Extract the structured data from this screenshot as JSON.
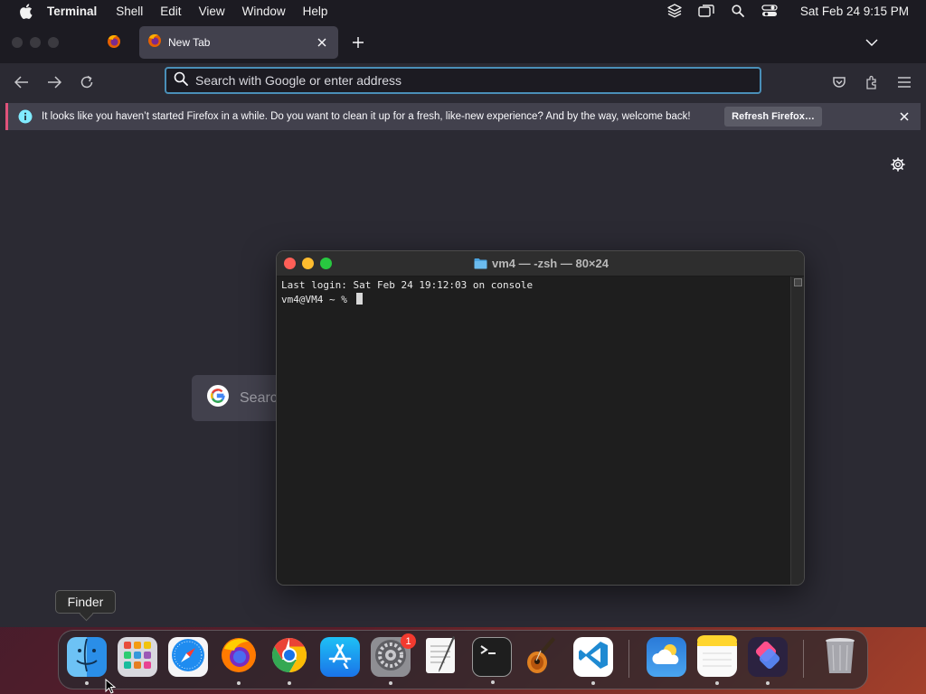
{
  "menubar": {
    "apple_icon": "apple-logo",
    "app_name": "Terminal",
    "menus": [
      "Shell",
      "Edit",
      "View",
      "Window",
      "Help"
    ],
    "status_icons": [
      "layers-icon",
      "screen-mirror-icon",
      "spotlight-search-icon",
      "control-center-icon"
    ],
    "clock": "Sat Feb 24  9:15 PM"
  },
  "firefox": {
    "pinned_tab_icon": "firefox-icon",
    "active_tab": {
      "title": "New Tab",
      "icon": "firefox-icon"
    },
    "urlbar": {
      "placeholder": "Search with Google or enter address"
    },
    "notification": {
      "message": "It looks like you haven’t started Firefox in a while. Do you want to clean it up for a fresh, like-new experience? And by the way, welcome back!",
      "button": "Refresh Firefox…"
    },
    "google_search": {
      "label": "Search"
    }
  },
  "terminal": {
    "title": "vm4 — -zsh — 80×24",
    "lines": [
      "Last login: Sat Feb 24 19:12:03 on console",
      "vm4@VM4 ~ % "
    ]
  },
  "tooltip": {
    "text": "Finder"
  },
  "dock": {
    "items": [
      {
        "name": "Finder",
        "icon": "finder-icon",
        "running": true
      },
      {
        "name": "Launchpad",
        "icon": "launchpad-icon",
        "running": false
      },
      {
        "name": "Safari",
        "icon": "safari-icon",
        "running": false
      },
      {
        "name": "Firefox",
        "icon": "firefox-icon",
        "running": true
      },
      {
        "name": "Google Chrome",
        "icon": "chrome-icon",
        "running": true
      },
      {
        "name": "App Store",
        "icon": "app-store-icon",
        "running": false
      },
      {
        "name": "System Settings",
        "icon": "settings-icon",
        "running": true,
        "badge": "1"
      },
      {
        "name": "TextEdit",
        "icon": "textedit-icon",
        "running": false
      },
      {
        "name": "Terminal",
        "icon": "terminal-icon",
        "running": true
      },
      {
        "name": "GarageBand",
        "icon": "garageband-icon",
        "running": false
      },
      {
        "name": "Visual Studio Code",
        "icon": "vscode-icon",
        "running": true
      },
      {
        "name": "Weather",
        "icon": "weather-icon",
        "running": false
      },
      {
        "name": "Notes",
        "icon": "notes-icon",
        "running": true
      },
      {
        "name": "Shortcuts",
        "icon": "shortcuts-icon",
        "running": true
      },
      {
        "name": "Trash",
        "icon": "trash-icon",
        "running": false
      }
    ]
  },
  "colors": {
    "menubar_bg": "#1c1b22",
    "firefox_bg": "#2b2a33",
    "urlbar_border": "#4a8fb8",
    "notification_accent": "#e0527a",
    "terminal_bg": "#1e1e1e",
    "badge_red": "#f23a2f"
  }
}
